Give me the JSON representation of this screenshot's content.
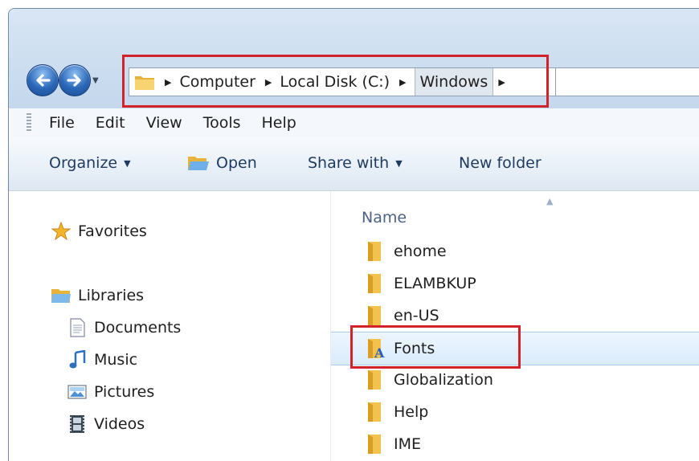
{
  "address": {
    "crumbs": [
      "Computer",
      "Local Disk (C:)"
    ],
    "current": "Windows"
  },
  "menu": {
    "items": [
      "File",
      "Edit",
      "View",
      "Tools",
      "Help"
    ]
  },
  "toolbar": {
    "organize": "Organize",
    "open": "Open",
    "share_with": "Share with",
    "new_folder": "New folder"
  },
  "nav": {
    "favorites": "Favorites",
    "libraries": "Libraries",
    "documents": "Documents",
    "music": "Music",
    "pictures": "Pictures",
    "videos": "Videos"
  },
  "list": {
    "column_name": "Name",
    "files": [
      "ehome",
      "ELAMBKUP",
      "en-US",
      "Fonts",
      "Globalization",
      "Help",
      "IME"
    ],
    "selected_index": 3
  },
  "colors": {
    "highlight_red": "#d2232a",
    "selection_blue": "#d9ebfc",
    "folder_yellow": "#f3c24c"
  }
}
